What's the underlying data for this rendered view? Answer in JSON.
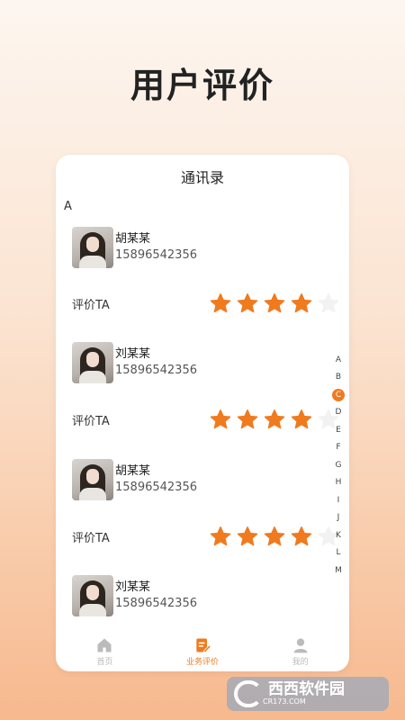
{
  "headline": "用户评价",
  "screen": {
    "title": "通讯录",
    "section_letter": "A",
    "contacts": [
      {
        "name": "胡某某",
        "phone": "15896542356",
        "rate_label": "评价TA",
        "rating": 4,
        "max": 5
      },
      {
        "name": "刘某某",
        "phone": "15896542356",
        "rate_label": "评价TA",
        "rating": 4,
        "max": 5
      },
      {
        "name": "胡某某",
        "phone": "15896542356",
        "rate_label": "评价TA",
        "rating": 4,
        "max": 5
      },
      {
        "name": "刘某某",
        "phone": "15896542356"
      }
    ],
    "index_letters": [
      "A",
      "B",
      "C",
      "D",
      "E",
      "F",
      "G",
      "H",
      "I",
      "J",
      "K",
      "L",
      "M"
    ],
    "index_active": "C",
    "tabs": [
      {
        "label": "首页",
        "icon": "home-icon",
        "active": false
      },
      {
        "label": "业务评价",
        "icon": "edit-icon",
        "active": true
      },
      {
        "label": "我的",
        "icon": "user-icon",
        "active": false
      }
    ]
  },
  "watermark": {
    "name": "西西软件园",
    "url": "CR173.COM"
  },
  "colors": {
    "accent": "#f07a1e",
    "star_empty": "#f2f2f2",
    "text": "#222222"
  }
}
